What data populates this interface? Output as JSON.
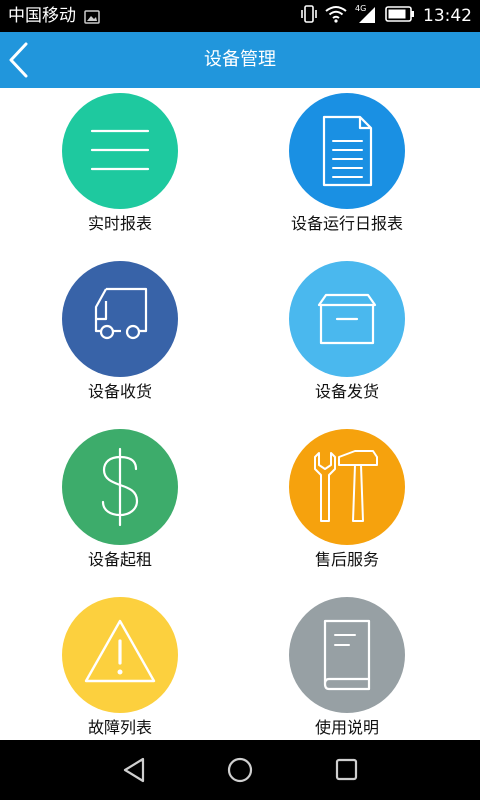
{
  "status_bar": {
    "carrier": "中国移动",
    "network": "4G",
    "time": "13:42",
    "icons": [
      "notification-image-icon",
      "vibrate-icon",
      "wifi-icon",
      "signal-icon",
      "battery-icon"
    ]
  },
  "app_bar": {
    "title": "设备管理",
    "back_icon": "chevron-left-icon",
    "background_color": "#2196dc"
  },
  "menu": {
    "items": [
      {
        "label": "实时报表",
        "icon": "menu-lines-icon",
        "color": "#1ec99f"
      },
      {
        "label": "设备运行日报表",
        "icon": "document-icon",
        "color": "#1a90e3"
      },
      {
        "label": "设备收货",
        "icon": "truck-icon",
        "color": "#3863a8"
      },
      {
        "label": "设备发货",
        "icon": "box-icon",
        "color": "#4ab8ee"
      },
      {
        "label": "设备起租",
        "icon": "dollar-icon",
        "color": "#3dac6b"
      },
      {
        "label": "售后服务",
        "icon": "tools-icon",
        "color": "#f6a20d"
      },
      {
        "label": "故障列表",
        "icon": "warning-icon",
        "color": "#fcd03e"
      },
      {
        "label": "使用说明",
        "icon": "book-icon",
        "color": "#97a0a4"
      }
    ]
  },
  "nav_bar": {
    "icons": [
      "back-triangle-icon",
      "home-circle-icon",
      "recents-square-icon"
    ]
  }
}
